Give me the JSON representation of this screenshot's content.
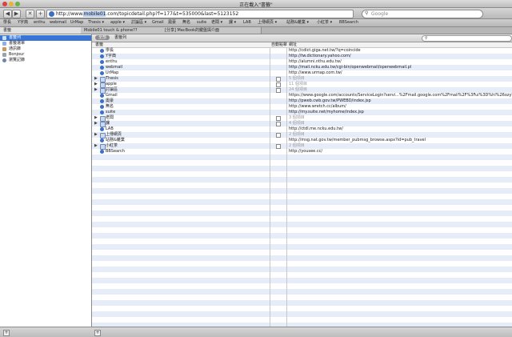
{
  "window": {
    "title": "正在載入\"書籤\""
  },
  "toolbar": {
    "back": "◀",
    "forward": "▶",
    "stop": "✕",
    "add": "+",
    "url_scheme": "http://www.",
    "url_sel": "mobile01",
    "url_rest": ".com/topicdetail.php?f=177&t=535000&last=5123152",
    "search_placeholder": "Google"
  },
  "bookmarks_bar": [
    "學長",
    "Y字典",
    "enthu",
    "webmail",
    "UrMap",
    "Thesis ▾",
    "apple ▾",
    "討論區 ▾",
    "Gmail",
    "奧豪",
    "無名",
    "suite",
    "老闆 ▾",
    "課 ▾",
    "LAB",
    "上傳網頁 ▾",
    "站務&雜業 ▾",
    "小紅茶 ▾",
    "BBSearch"
  ],
  "tabs": [
    {
      "label": "書籤"
    },
    {
      "label": "Mobile01 touch & phone??"
    },
    {
      "label": "[分享] MacBook的鍵盤與介面"
    }
  ],
  "sidebar": {
    "items": [
      {
        "label": "書籤列"
      },
      {
        "label": "書籤選單"
      },
      {
        "label": "通訊錄"
      },
      {
        "label": "Bonjour"
      },
      {
        "label": "瀏覽記錄"
      }
    ]
  },
  "main": {
    "filter_on": "全部",
    "filter_off": "書籤列",
    "search_placeholder": "",
    "col_name": "書籤",
    "col_auto": "自動點擊",
    "col_addr": "網址"
  },
  "rows": [
    {
      "name": "學長",
      "addr": "http://cdict.giga.net.tw/?q=coincide",
      "folder": false
    },
    {
      "name": "Y字典",
      "addr": "http://tw.dictionary.yahoo.com/",
      "folder": false
    },
    {
      "name": "enthu",
      "addr": "http://alumni.nthu.edu.tw/",
      "folder": false
    },
    {
      "name": "webmail",
      "addr": "http://mail.ncku.edu.tw/cgi-bin/openwebmail/openwebmail.pl",
      "folder": false
    },
    {
      "name": "UrMap",
      "addr": "http://www.urmap.com.tw/",
      "folder": false
    },
    {
      "name": "Thesis",
      "addr": "5 個項目",
      "folder": true
    },
    {
      "name": "apple",
      "addr": "11 個項目",
      "folder": true
    },
    {
      "name": "討論區",
      "addr": "24 個項目",
      "folder": true
    },
    {
      "name": "Gmail",
      "addr": "https://www.google.com/accounts/ServiceLogin?servi...%2Fmail.google.com%2Fmail%2F%3Fui%3D%hl%26ozy%3D",
      "folder": false
    },
    {
      "name": "奧豪",
      "addr": "http://pweb.cwb.gov.tw/PWEBD/index.jsp",
      "folder": false
    },
    {
      "name": "無名",
      "addr": "http://www.wretch.cc/album/",
      "folder": false
    },
    {
      "name": "suite",
      "addr": "http://my.suite.net/myhome/index.jsp",
      "folder": false
    },
    {
      "name": "老闆",
      "addr": "3 個項目",
      "folder": true
    },
    {
      "name": "課",
      "addr": "4 個項目",
      "folder": true
    },
    {
      "name": "LAB",
      "addr": "http://ctdl.me.ncku.edu.tw/",
      "folder": false
    },
    {
      "name": "上傳網頁",
      "addr": "2 個項目",
      "folder": true
    },
    {
      "name": "站務&雜業",
      "addr": "http://msg.nat.gov.tw/member_pubmsg_browse.aspx?id=pub_travel",
      "folder": false
    },
    {
      "name": "小紅茶",
      "addr": "2 個項目",
      "folder": true
    },
    {
      "name": "BBSearch",
      "addr": "http://yousee.cc/",
      "folder": false
    }
  ],
  "statusbar": {
    "add": "+"
  }
}
